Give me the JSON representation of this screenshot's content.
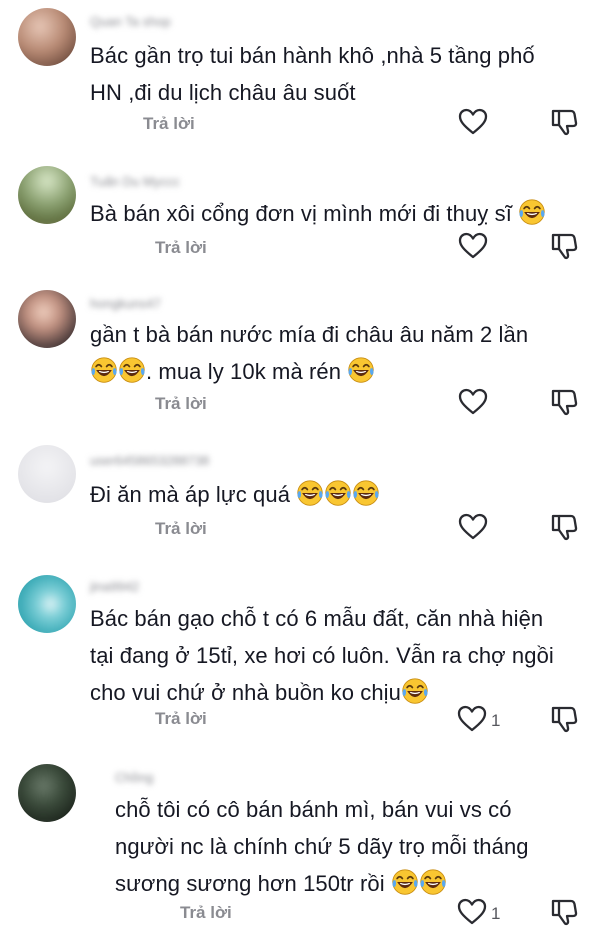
{
  "comments": [
    {
      "username": "Quan Ta shop",
      "lines": [
        "Bác gần trọ tui bán hành khô ,nhà 5 tầng phố",
        "HN ,đi du lịch châu âu suốt"
      ],
      "reply": "Trả lời",
      "likes": ""
    },
    {
      "username": "Tuấn Du Myccc",
      "lines": [
        "Bà bán xôi cổng đơn vị mình mới đi thuỵ sĩ"
      ],
      "reply": "Trả lời",
      "likes": ""
    },
    {
      "username": "hongkuns47",
      "lines": [
        "gần t bà bán nước mía đi châu âu năm 2 lần",
        ". mua ly 10k mà rén"
      ],
      "reply": "Trả lời",
      "likes": ""
    },
    {
      "username": "user6458653288738",
      "lines": [
        "Đi ăn mà áp lực quá"
      ],
      "reply": "Trả lời",
      "likes": ""
    },
    {
      "username": "jina9942",
      "lines": [
        "Bác bán gạo chỗ t có 6 mẫu đất, căn nhà hiện",
        "tại đang ở 15tỉ, xe hơi có luôn. Vẫn ra chợ ngồi",
        "cho vui chứ ở nhà buồn ko chịu"
      ],
      "reply": "Trả lời",
      "likes": "1"
    },
    {
      "username": "Chồng",
      "lines": [
        "chỗ tôi có cô bán bánh mì, bán vui vs có",
        "người nc là chính chứ 5 dãy trọ mỗi tháng",
        "sương sương hơn 150tr rồi"
      ],
      "reply": "Trả lời",
      "likes": "1"
    }
  ],
  "colors": {
    "text": "#161823",
    "secondary": "#8a8b91",
    "emoji": "#f9c631"
  },
  "icons": [
    "laughing-tears-emoji",
    "heart-outline-icon",
    "dislike-thumb-icon"
  ]
}
